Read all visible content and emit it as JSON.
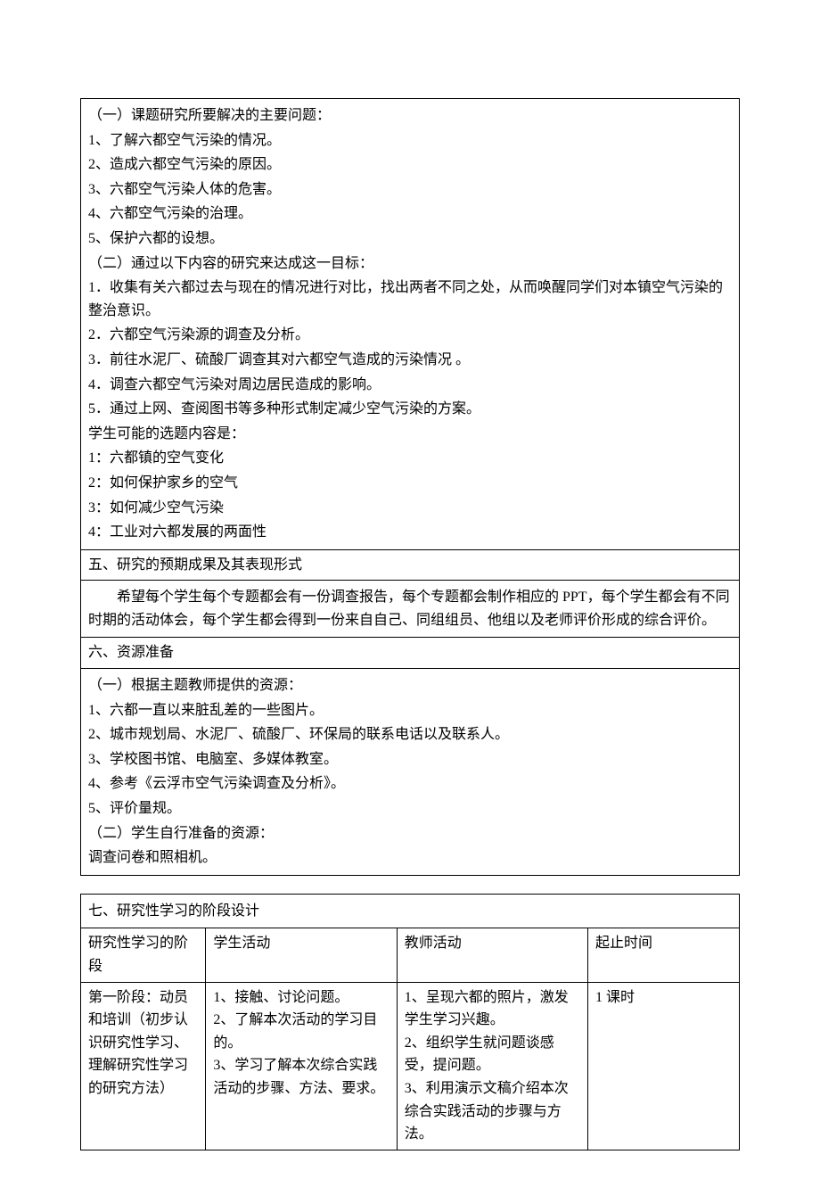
{
  "section1": {
    "header1": "（一）课题研究所要解决的主要问题：",
    "items1": [
      "1、了解六都空气污染的情况。",
      "2、造成六都空气污染的原因。",
      "3、六都空气污染人体的危害。",
      "4、六都空气污染的治理。",
      "5、保护六都的设想。"
    ],
    "header2": "（二）通过以下内容的研究来达成这一目标：",
    "items2": [
      "1．收集有关六都过去与现在的情况进行对比，找出两者不同之处，从而唤醒同学们对本镇空气污染的整治意识。",
      "2．六都空气污染源的调查及分析。",
      "3．前往水泥厂、硫酸厂调查其对六都空气造成的污染情况 。",
      "4．调查六都空气污染对周边居民造成的影响。",
      "5．通过上网、查阅图书等多种形式制定减少空气污染的方案。"
    ],
    "header3": "学生可能的选题内容是：",
    "items3": [
      "1：六都镇的空气变化",
      "2：如何保护家乡的空气",
      "3：如何减少空气污染",
      "4：工业对六都发展的两面性"
    ]
  },
  "section5": {
    "title": "五、研究的预期成果及其表现形式",
    "content": "希望每个学生每个专题都会有一份调查报告，每个专题都会制作相应的 PPT，每个学生都会有不同时期的活动体会，每个学生都会得到一份来自自己、同组组员、他组以及老师评价形成的综合评价。"
  },
  "section6": {
    "title": "六、资源准备",
    "header1": "（一）根据主题教师提供的资源：",
    "items1": [
      "1、六都一直以来脏乱差的一些图片。",
      "2、城市规划局、水泥厂、硫酸厂、环保局的联系电话以及联系人。",
      "3、学校图书馆、电脑室、多媒体教室。",
      "4、参考《云浮市空气污染调查及分析》。",
      "5、评价量规。"
    ],
    "header2": "（二）学生自行准备的资源：",
    "footer": "调查问卷和照相机。"
  },
  "section7": {
    "title": "七、研究性学习的阶段设计",
    "headers": {
      "col1": "研究性学习的阶段",
      "col2": "学生活动",
      "col3": "教师活动",
      "col4": "起止时间"
    },
    "row1": {
      "phase": "第一阶段：动员和培训（初步认识研究性学习、理解研究性学习的研究方法）",
      "student": "1、接触、讨论问题。\n2、了解本次活动的学习目的。\n3、学习了解本次综合实践活动的步骤、方法、要求。",
      "teacher": "1、呈现六都的照片，激发学生学习兴趣。\n2、组织学生就问题谈感受，提问题。\n3、利用演示文稿介绍本次综合实践活动的步骤与方法。",
      "time": "1 课时"
    }
  }
}
